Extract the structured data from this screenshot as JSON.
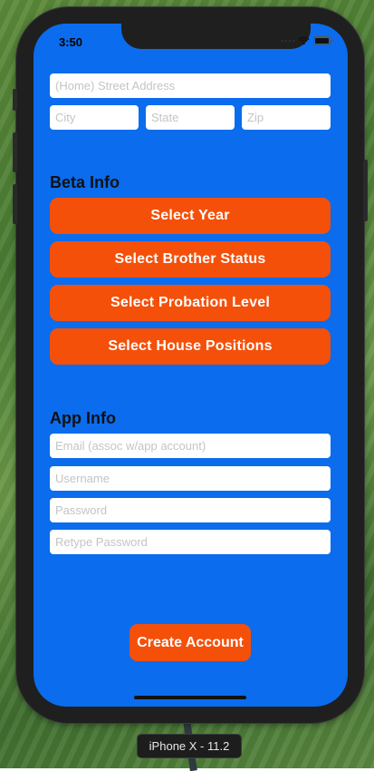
{
  "status_bar": {
    "time": "3:50"
  },
  "address": {
    "street_placeholder": "(Home) Street Address",
    "city_placeholder": "City",
    "state_placeholder": "State",
    "zip_placeholder": "Zip"
  },
  "beta_info": {
    "title": "Beta Info",
    "select_year": "Select Year",
    "select_brother_status": "Select Brother Status",
    "select_probation_level": "Select Probation Level",
    "select_house_positions": "Select House Positions"
  },
  "app_info": {
    "title": "App Info",
    "email_placeholder": "Email (assoc w/app account)",
    "username_placeholder": "Username",
    "password_placeholder": "Password",
    "retype_password_placeholder": "Retype Password"
  },
  "create_account_label": "Create Account",
  "device_label": "iPhone X - 11.2",
  "colors": {
    "screen_background": "#0b6ced",
    "button_orange": "#f4500a"
  }
}
